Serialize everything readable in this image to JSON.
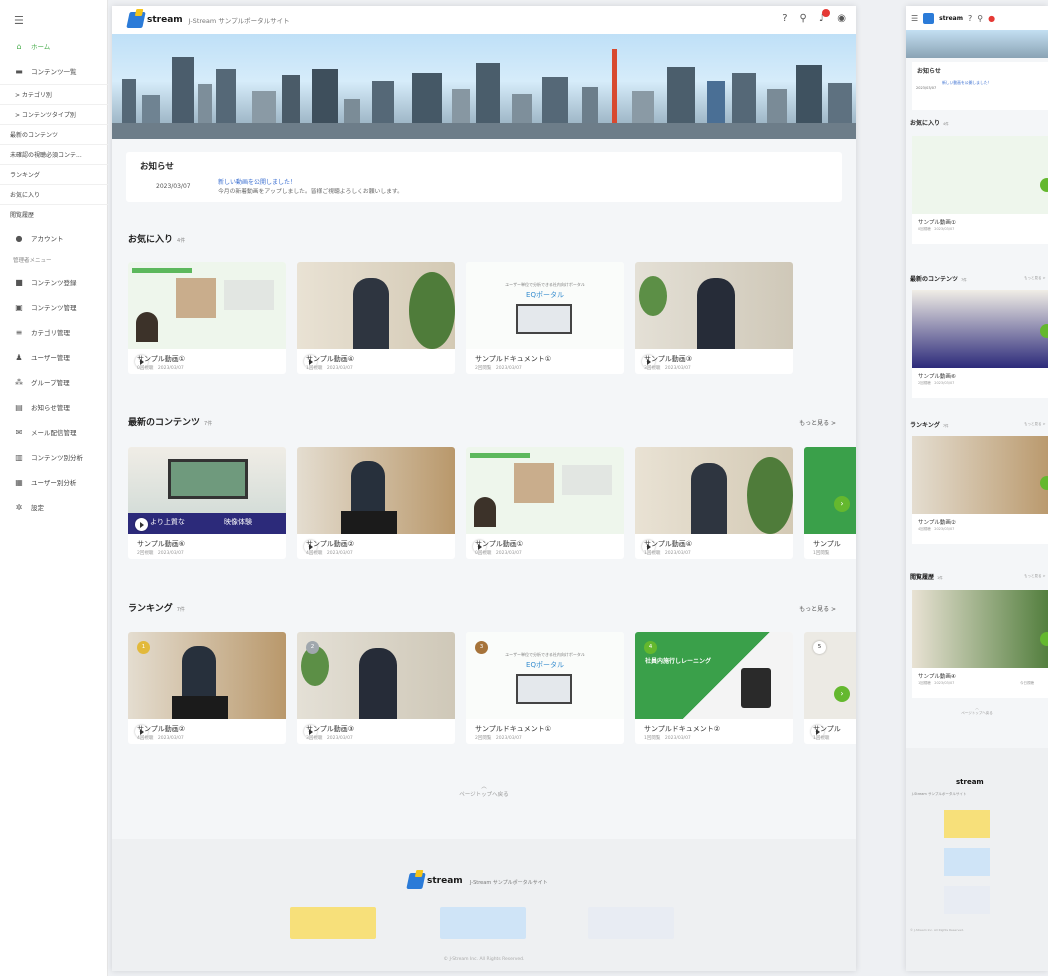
{
  "app": {
    "logo_text": "stream",
    "site_title": "J-Stream サンプルポータルサイト"
  },
  "sidebar": {
    "items": [
      {
        "label": "ホーム",
        "icon": "home-icon"
      },
      {
        "label": "コンテンツ一覧",
        "icon": "film-icon"
      },
      {
        "label": "アカウント",
        "icon": "account-icon"
      },
      {
        "label": "コンテンツ登録",
        "icon": "video-add-icon"
      },
      {
        "label": "コンテンツ管理",
        "icon": "library-icon"
      },
      {
        "label": "カテゴリ管理",
        "icon": "list-icon"
      },
      {
        "label": "ユーザー管理",
        "icon": "users-icon"
      },
      {
        "label": "グループ管理",
        "icon": "group-icon"
      },
      {
        "label": "お知らせ管理",
        "icon": "announcement-icon"
      },
      {
        "label": "メール配信管理",
        "icon": "mail-icon"
      },
      {
        "label": "コンテンツ別分析",
        "icon": "analytics-icon"
      },
      {
        "label": "ユーザー別分析",
        "icon": "user-analytics-icon"
      },
      {
        "label": "設定",
        "icon": "gear-icon"
      }
    ],
    "sub": [
      "> カテゴリ別",
      "> コンテンツタイプ別",
      "最新のコンテンツ",
      "未確認の視聴必須コンテ...",
      "ランキング",
      "お気に入り",
      "閲覧履歴"
    ],
    "admin_label": "管理者メニュー"
  },
  "notice": {
    "heading": "お知らせ",
    "date": "2023/03/07",
    "title": "新しい動画を公開しました！",
    "body": "今月の新着動画をアップしました。皆様ご視聴よろしくお願いします。"
  },
  "sections": {
    "favorites": {
      "title": "お気に入り",
      "count": "4件",
      "cards": [
        {
          "name": "サンプル動画①",
          "meta": "0回視聴　2023/03/07"
        },
        {
          "name": "サンプル動画④",
          "meta": "1回視聴　2023/03/07"
        },
        {
          "name": "サンプルドキュメント①",
          "meta": "2回閲覧　2023/03/07"
        },
        {
          "name": "サンプル動画③",
          "meta": "3回視聴　2023/03/07"
        }
      ]
    },
    "latest": {
      "title": "最新のコンテンツ",
      "count": "7件",
      "more": "もっと見る >",
      "cards": [
        {
          "name": "サンプル動画⑥",
          "meta": "2回視聴　2023/03/07"
        },
        {
          "name": "サンプル動画②",
          "meta": "4回視聴　2023/03/07"
        },
        {
          "name": "サンプル動画①",
          "meta": "0回視聴　2023/03/07"
        },
        {
          "name": "サンプル動画④",
          "meta": "1回視聴　2023/03/07"
        },
        {
          "name": "サンプル",
          "meta": "1回閲覧"
        }
      ]
    },
    "ranking": {
      "title": "ランキング",
      "count": "7件",
      "more": "もっと見る >",
      "cards": [
        {
          "rank": "1",
          "name": "サンプル動画②",
          "meta": "4回視聴　2023/03/07"
        },
        {
          "rank": "2",
          "name": "サンプル動画③",
          "meta": "3回視聴　2023/03/07"
        },
        {
          "rank": "3",
          "name": "サンプルドキュメント①",
          "meta": "2回閲覧　2023/03/07"
        },
        {
          "rank": "4",
          "name": "サンプルドキュメント②",
          "meta": "1回閲覧　2023/03/07"
        },
        {
          "rank": "5",
          "name": "サンプル",
          "meta": "1回視聴"
        }
      ]
    }
  },
  "thumb_texts": {
    "eq_portal": "EQポータル",
    "eq_tagline": "ユーザー単位で分析できる社内向けポータル",
    "catch1": "より上質な",
    "catch2": "映像体験",
    "green_doc": "社員内施行しレーニング"
  },
  "totop": "ページトップへ戻る",
  "copyright": "© J-Stream Inc. All Rights Reserved.",
  "mobile": {
    "notice_heading": "お知らせ",
    "notice_date": "2023/03/07",
    "notice_title": "新しい動画を公開しました！",
    "fav_title": "お気に入り",
    "fav_count": "4件",
    "fav_card": "サンプル動画①",
    "fav_meta": "0回視聴　2023/03/07",
    "latest_title": "最新のコンテンツ",
    "latest_count": "7件",
    "more": "もっと見る >",
    "latest_card": "サンプル動画⑥",
    "latest_meta": "2回視聴　2023/03/07",
    "rank_title": "ランキング",
    "rank_count": "7件",
    "rank_card": "サンプル動画②",
    "rank_meta": "4回視聴　2023/03/07",
    "hist_title": "閲覧履歴",
    "hist_count": "1件",
    "hist_card": "サンプル動画④",
    "hist_meta": "1回視聴　2023/03/07",
    "hist_extra": "今日視聴"
  },
  "colors": {
    "accent": "#4caf50",
    "next": "#64b82e",
    "link": "#3b6fd1"
  }
}
